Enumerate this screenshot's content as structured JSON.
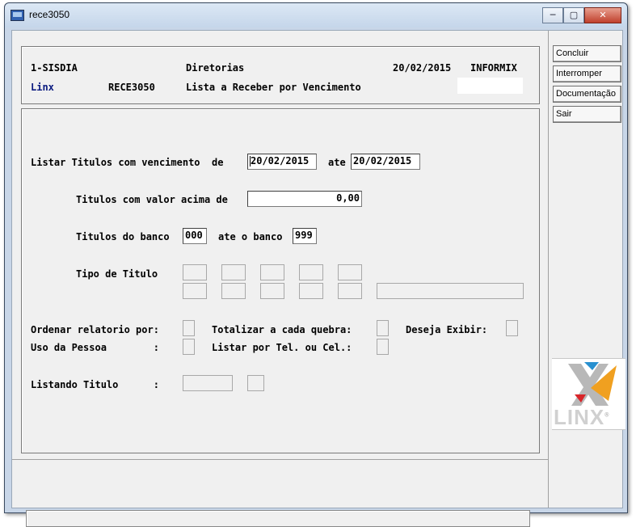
{
  "window": {
    "title": "rece3050",
    "minimize_glyph": "─",
    "maximize_glyph": "▢",
    "close_glyph": "✕"
  },
  "header": {
    "system": "1-SISDIA",
    "section": "Diretorias",
    "date": "20/02/2015",
    "db": "INFORMIX",
    "company": "Linx",
    "program": "RECE3050",
    "report_name": "Lista a Receber por Vencimento"
  },
  "form": {
    "due_label": "Listar Titulos com vencimento  de",
    "due_from": "20/02/2015",
    "due_to_label": "ate",
    "due_to": "20/02/2015",
    "value_label": "Titulos com valor acima de",
    "value": "0,00",
    "bank_label": "Titulos do banco",
    "bank_from": "000",
    "bank_to_label": "ate o banco",
    "bank_to": "999",
    "type_label": "Tipo de Titulo",
    "order_label": "Ordenar relatorio por:",
    "totalize_label": "Totalizar a cada quebra:",
    "display_label": "Deseja Exibir:",
    "person_use_label": "Uso da Pessoa        :",
    "phone_label": "Listar por Tel. ou Cel.:",
    "listing_label": "Listando Titulo      :"
  },
  "sidebar": {
    "buttons": [
      "Concluir",
      "Interromper",
      "Documentação",
      "Sair"
    ],
    "logo_text": "LINX",
    "logo_mark": "®"
  },
  "colors": {
    "logo_gray": "#b8b8b8",
    "logo_red": "#d8262a",
    "logo_orange": "#f0a020",
    "logo_blue": "#2890d0"
  }
}
